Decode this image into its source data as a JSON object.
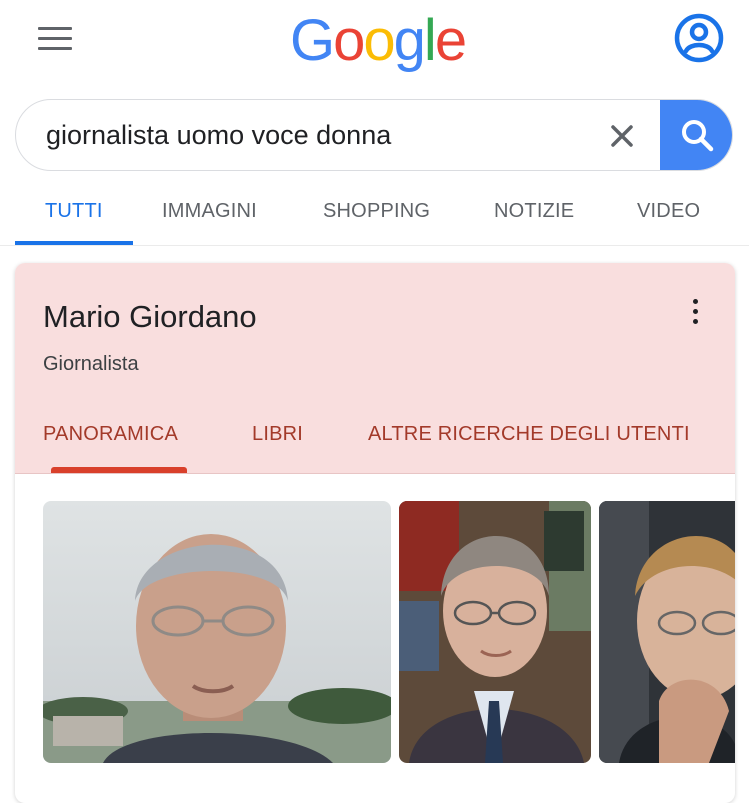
{
  "header": {
    "logo_letters": [
      "G",
      "o",
      "o",
      "g",
      "l",
      "e"
    ],
    "logo_colors": [
      "#4285f4",
      "#ea4335",
      "#fbbc05",
      "#4285f4",
      "#34a853",
      "#ea4335"
    ]
  },
  "search": {
    "query": "giornalista uomo voce donna"
  },
  "tabs": [
    {
      "label": "TUTTI",
      "active": true
    },
    {
      "label": "IMMAGINI"
    },
    {
      "label": "SHOPPING"
    },
    {
      "label": "NOTIZIE"
    },
    {
      "label": "VIDEO"
    }
  ],
  "panel": {
    "title": "Mario Giordano",
    "subtitle": "Giornalista",
    "tabs": [
      {
        "label": "PANORAMICA",
        "active": true
      },
      {
        "label": "LIBRI"
      },
      {
        "label": "ALTRE RICERCHE DEGLI UTENTI"
      }
    ]
  },
  "colors": {
    "accent": "#1a73e8",
    "panel_header_bg": "#f9dede",
    "panel_tab_text": "#a33a2a",
    "panel_tab_indicator": "#d9402b"
  }
}
